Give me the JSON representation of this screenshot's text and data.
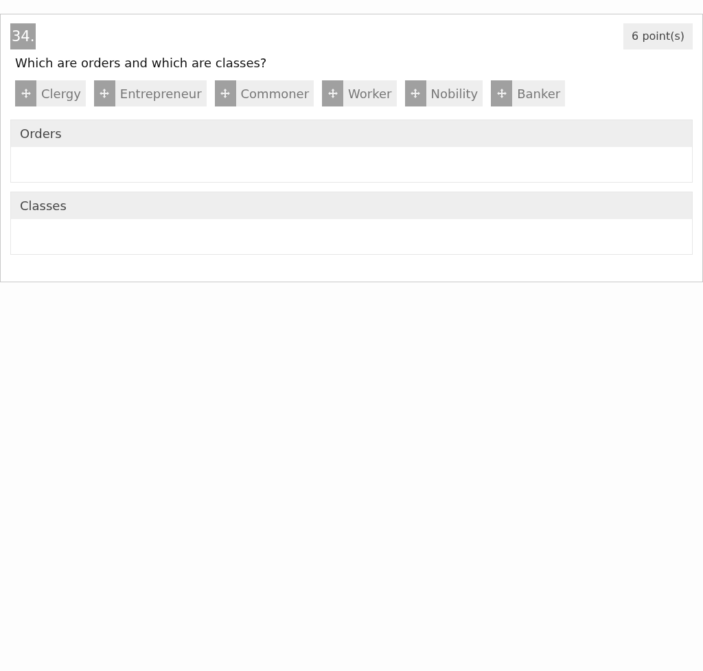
{
  "question": {
    "number": "34.",
    "points": "6 point(s)",
    "prompt": "Which are orders and which are classes?"
  },
  "items": [
    "Clergy",
    "Entrepreneur",
    "Commoner",
    "Worker",
    "Nobility",
    "Banker"
  ],
  "zones": [
    {
      "label": "Orders"
    },
    {
      "label": "Classes"
    }
  ]
}
